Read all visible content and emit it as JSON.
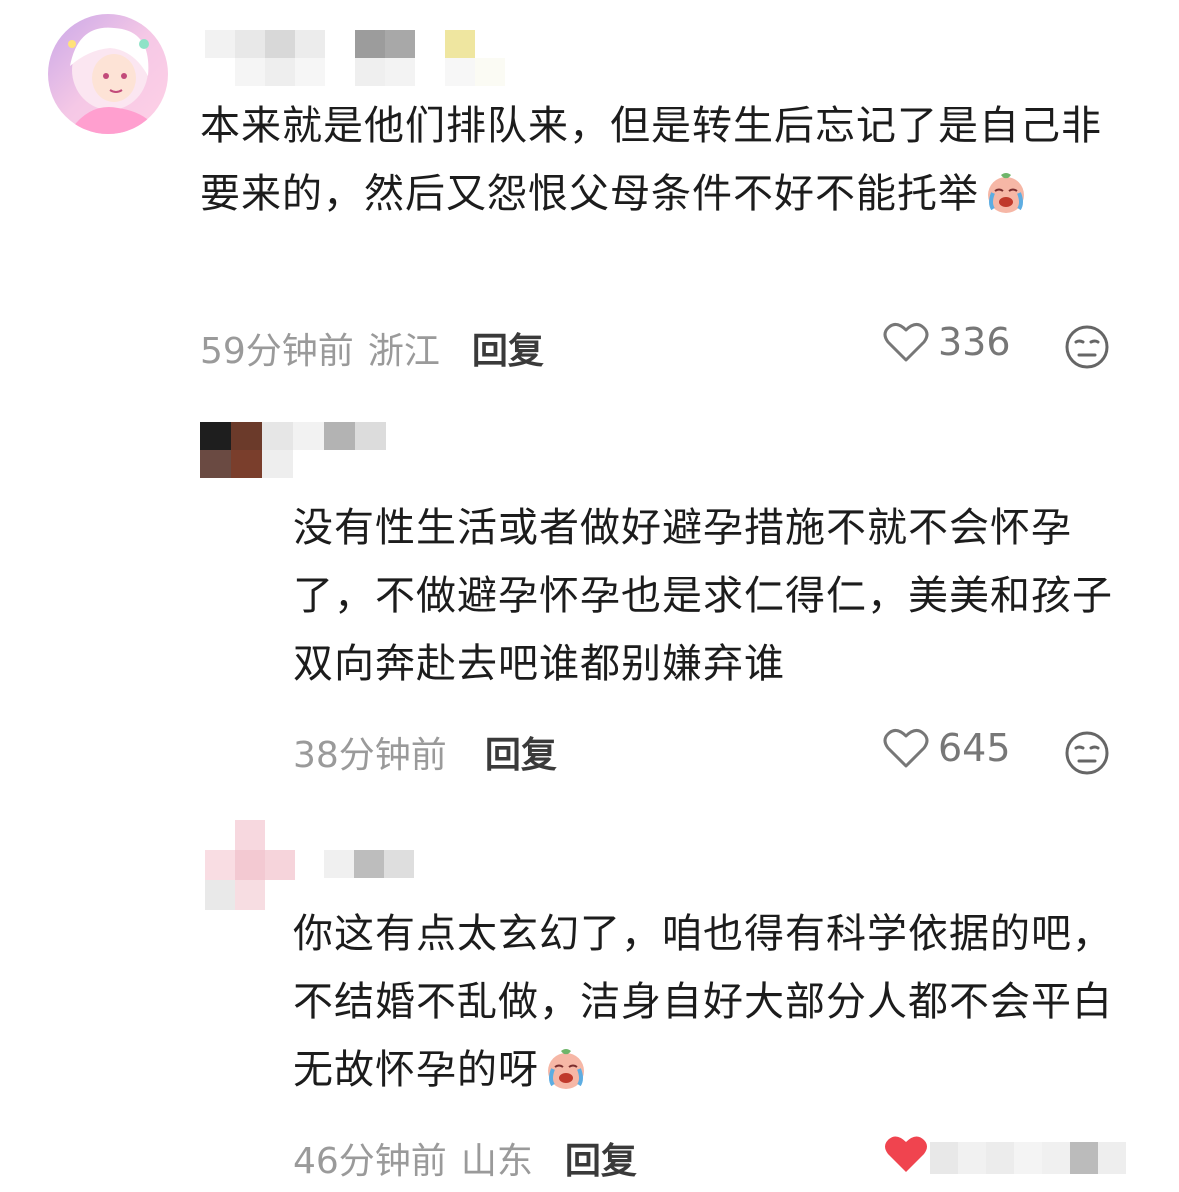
{
  "comments": [
    {
      "text": "本来就是他们排队来，但是转生后忘记了是自己非要来的，然后又怨恨父母条件不好不能托举",
      "time": "59分钟前",
      "location": "浙江",
      "reply_label": "回复",
      "likes": "336",
      "emoji": "crying-face-icon"
    },
    {
      "text": "没有性生活或者做好避孕措施不就不会怀孕了，不做避孕怀孕也是求仁得仁，美美和孩子双向奔赴去吧谁都别嫌弃谁",
      "time": "38分钟前",
      "reply_label": "回复",
      "likes": "645"
    },
    {
      "text": "你这有点太玄幻了，咱也得有科学依据的吧，不结婚不乱做，洁身自好大部分人都不会平白无故怀孕的呀",
      "time": "46分钟前",
      "location": "山东",
      "reply_label": "回复",
      "emoji": "crying-face-icon"
    }
  ],
  "colors": {
    "like_red": "#f0444f",
    "meta_gray": "#9a9a9a",
    "text": "#1c1c1c"
  }
}
